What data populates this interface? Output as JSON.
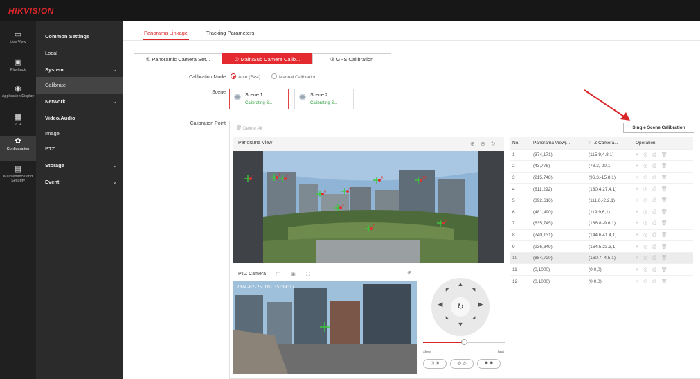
{
  "brand": {
    "logo": "HIKVISION"
  },
  "icon_nav": [
    {
      "label": "Live View",
      "icon": "monitor-icon"
    },
    {
      "label": "Playback",
      "icon": "playback-icon"
    },
    {
      "label": "Application Display",
      "icon": "app-display-icon"
    },
    {
      "label": "VCA",
      "icon": "vca-icon"
    },
    {
      "label": "Configuration",
      "icon": "gear-icon"
    },
    {
      "label": "Maintenance and Security",
      "icon": "maintenance-icon"
    }
  ],
  "menu": [
    {
      "label": "Common Settings"
    },
    {
      "label": "Local"
    },
    {
      "label": "System"
    },
    {
      "label": "Calibrate"
    },
    {
      "label": "Network"
    },
    {
      "label": "Video/Audio"
    },
    {
      "label": "Image"
    },
    {
      "label": "PTZ"
    },
    {
      "label": "Storage"
    },
    {
      "label": "Event"
    }
  ],
  "tabs": [
    {
      "label": "Panorama Linkage"
    },
    {
      "label": "Tracking Parameters"
    }
  ],
  "steps": [
    {
      "label": "① Panoramic Camera Set..."
    },
    {
      "label": "② Main/Sub Camera Calib..."
    },
    {
      "label": "③ GPS Calibration"
    }
  ],
  "form": {
    "calibration_mode_label": "Calibration Mode",
    "mode_auto": "Auto (Fast)",
    "mode_manual": "Manual Calibration",
    "scene_label": "Scene",
    "calibration_point_label": "Calibration Point"
  },
  "scenes": [
    {
      "name": "Scene 1",
      "status": "Calibrating S..."
    },
    {
      "name": "Scene 2",
      "status": "Calibrating S..."
    }
  ],
  "delete_all": "Delete All",
  "single_scene_calibration": "Single Scene Calibration",
  "panorama_view_title": "Panorama View",
  "ptz_camera_title": "PTZ Camera",
  "ptz_osd_timestamp": "2024-02-25 Thu 15:09:17",
  "ptz_speed": {
    "slow": "slow",
    "fast": "fast",
    "level": 0.5
  },
  "points_table": {
    "headers": [
      "No.",
      "Panorama View(...",
      "PTZ Camera...",
      "Operation"
    ],
    "rows": [
      [
        "1",
        "(374,171)",
        "(115.9,4.8,1)"
      ],
      [
        "2",
        "(43,778)",
        "(78.3,-20,1)"
      ],
      [
        "3",
        "(215,748)",
        "(96.3,-15.8,1)"
      ],
      [
        "4",
        "(611,292)",
        "(130.4,27.4,1)"
      ],
      [
        "5",
        "(392,616)",
        "(111.6,-2.2,1)"
      ],
      [
        "6",
        "(481,490)",
        "(119.9,6,1)"
      ],
      [
        "7",
        "(635,745)",
        "(136.8,-9.6,1)"
      ],
      [
        "8",
        "(740,131)",
        "(144.6,41.4,1)"
      ],
      [
        "9",
        "(936,349)",
        "(164.5,23.3,1)"
      ],
      [
        "10",
        "(884,720)",
        "(160.7,-4.5,1)"
      ],
      [
        "11",
        "(0,1000)",
        "(0,0,0)"
      ],
      [
        "12",
        "(0,1000)",
        "(0,0,0)"
      ]
    ]
  },
  "panorama_markers": [
    "1",
    "2",
    "3",
    "4",
    "5",
    "6",
    "7",
    "8",
    "9",
    "10"
  ]
}
